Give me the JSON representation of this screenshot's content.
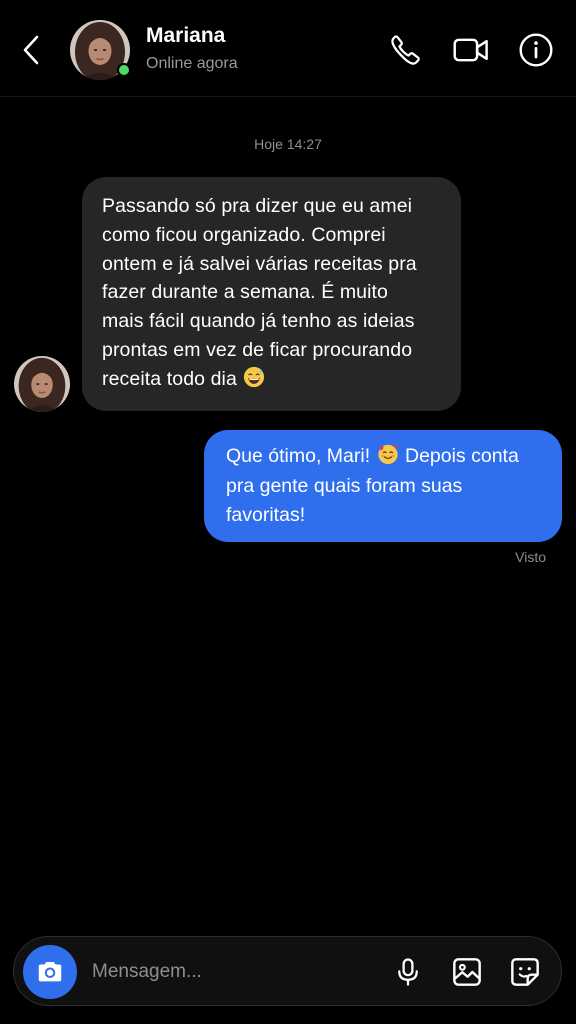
{
  "header": {
    "back_icon": "chevron-left-icon",
    "contact_name": "Mariana",
    "contact_status": "Online agora",
    "online_color": "#4cd964",
    "actions": [
      "phone-icon",
      "video-camera-icon",
      "info-icon"
    ]
  },
  "conversation": {
    "timestamp": "Hoje 14:27",
    "messages": [
      {
        "direction": "incoming",
        "sender": "Mariana",
        "lines": [
          "Passando só pra dizer que eu amei",
          "como ficou organizado. Comprei",
          "ontem e já salvei várias receitas pra",
          "fazer durante a semana. É muito",
          "mais fácil quando já tenho as ideias",
          "prontas em vez de ficar procurando",
          "receita todo dia"
        ],
        "emoji": "grinning-face-with-sweat-emoji"
      },
      {
        "direction": "outgoing",
        "line1_before_emoji": "Que ótimo, Mari!",
        "emoji": "smiling-face-with-hearts-emoji",
        "line1_after_emoji": "Depois conta",
        "lines": [
          "pra gente quais foram suas",
          "favoritas!"
        ],
        "status": "Visto"
      }
    ]
  },
  "composer": {
    "placeholder": "Mensagem...",
    "camera_icon": "camera-icon",
    "actions": [
      "microphone-icon",
      "image-gallery-icon",
      "sticker-icon"
    ]
  },
  "colors": {
    "background": "#000000",
    "incoming_bubble": "#262626",
    "outgoing_bubble": "#2f6fee",
    "accent": "#2f6fee",
    "muted_text": "#8e8e8e"
  }
}
